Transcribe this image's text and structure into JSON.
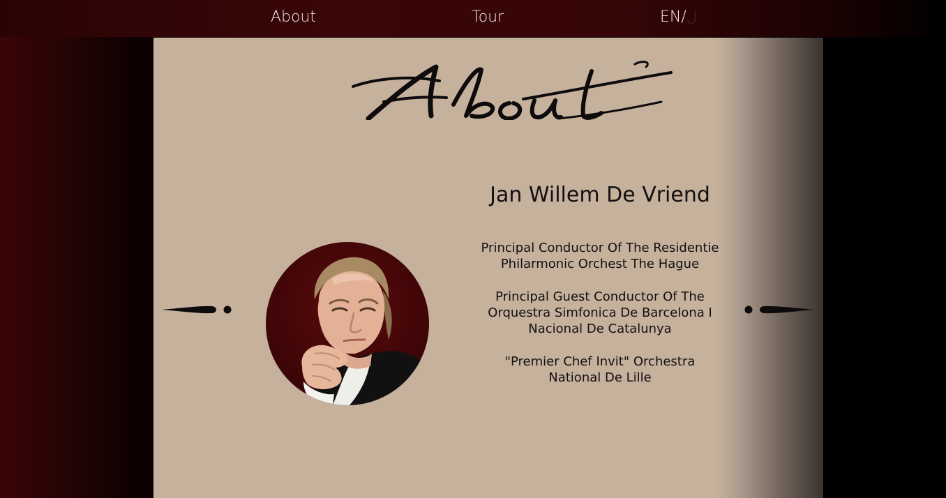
{
  "nav": {
    "about_label": "About",
    "tour_label": "Tour",
    "lang_label": "EN/",
    "lang_next": "ل"
  },
  "page": {
    "heading_script": "About"
  },
  "bio": {
    "name": "Jan Willem De Vriend",
    "roles": [
      "Principal Conductor Of The Residentie Philarmonic Orchest The Hague",
      "Principal Guest Conductor Of The Orquestra Simfonica De Barcelona I Nacional De Catalunya",
      "\"Premier Chef Invit\" Orchestra National De Lille"
    ]
  },
  "colors": {
    "nav_bg": "#3a0607",
    "panel_bg": "#c6b19d",
    "portrait_bg": "#4a0709",
    "text": "#121010"
  },
  "icons": {
    "ornament_left": "ornament-left-icon",
    "ornament_right": "ornament-right-icon",
    "portrait": "conductor-portrait"
  }
}
